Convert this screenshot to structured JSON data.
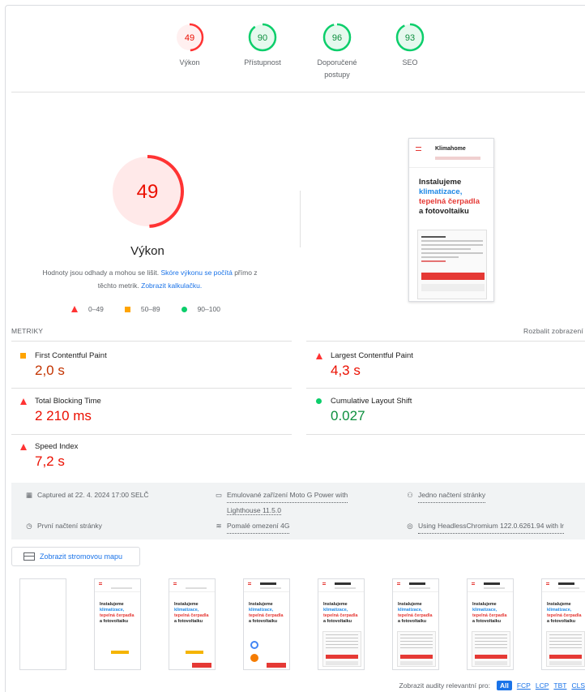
{
  "scores": [
    {
      "value": "49",
      "label": "Výkon",
      "status": "fail"
    },
    {
      "value": "90",
      "label": "Přístupnost",
      "status": "pass"
    },
    {
      "value": "96",
      "label": "Doporučené postupy",
      "status": "pass"
    },
    {
      "value": "93",
      "label": "SEO",
      "status": "pass"
    }
  ],
  "performance": {
    "score": "49",
    "score_fraction": 0.49,
    "title": "Výkon",
    "desc_before": "Hodnoty jsou odhady a mohou se lišit.",
    "desc_link1": "Skóre výkonu se počítá",
    "desc_middle": "přímo z těchto metrik.",
    "desc_link2": "Zobrazit kalkulačku."
  },
  "legend": {
    "fail": "0–49",
    "average": "50–89",
    "pass": "90–100"
  },
  "preview": {
    "brand": "Klimahome",
    "line1": "Instalujeme",
    "line2": "klimatizace,",
    "line3": "tepelná čerpadla",
    "line4": "a fotovoltaiku"
  },
  "metrics_header": {
    "title": "METRIKY",
    "expand": "Rozbalit zobrazení"
  },
  "metrics": {
    "fcp": {
      "name": "First Contentful Paint",
      "value": "2,0 s"
    },
    "lcp": {
      "name": "Largest Contentful Paint",
      "value": "4,3 s"
    },
    "tbt": {
      "name": "Total Blocking Time",
      "value": "2 210 ms"
    },
    "cls": {
      "name": "Cumulative Layout Shift",
      "value": "0.027"
    },
    "si": {
      "name": "Speed Index",
      "value": "7,2 s"
    }
  },
  "info": {
    "captured": "Captured at 22. 4. 2024 17:00 SELČ",
    "device_a": "Emulované zařízení Moto G Power with",
    "device_b": "Lighthouse 11.5.0",
    "load": "Jedno načtení stránky",
    "initial": "První načtení stránky",
    "throttle": "Pomalé omezení 4G",
    "browser": "Using HeadlessChromium 122.0.6261.94 with lr"
  },
  "treemap_button": "Zobrazit stromovou mapu",
  "filmstrip": {
    "line1": "Instalujeme",
    "line2": "klimatizace,",
    "line3": "tepelná čerpadla",
    "line4": "a fotovoltaiku"
  },
  "filter": {
    "label": "Zobrazit audity relevantní pro:",
    "all": "All",
    "fcp": "FCP",
    "lcp": "LCP",
    "tbt": "TBT",
    "cls": "CLS"
  },
  "colors": {
    "fail": "#ff3333",
    "average": "#ffa400",
    "pass": "#0cce6b",
    "link": "#1a73e8"
  }
}
